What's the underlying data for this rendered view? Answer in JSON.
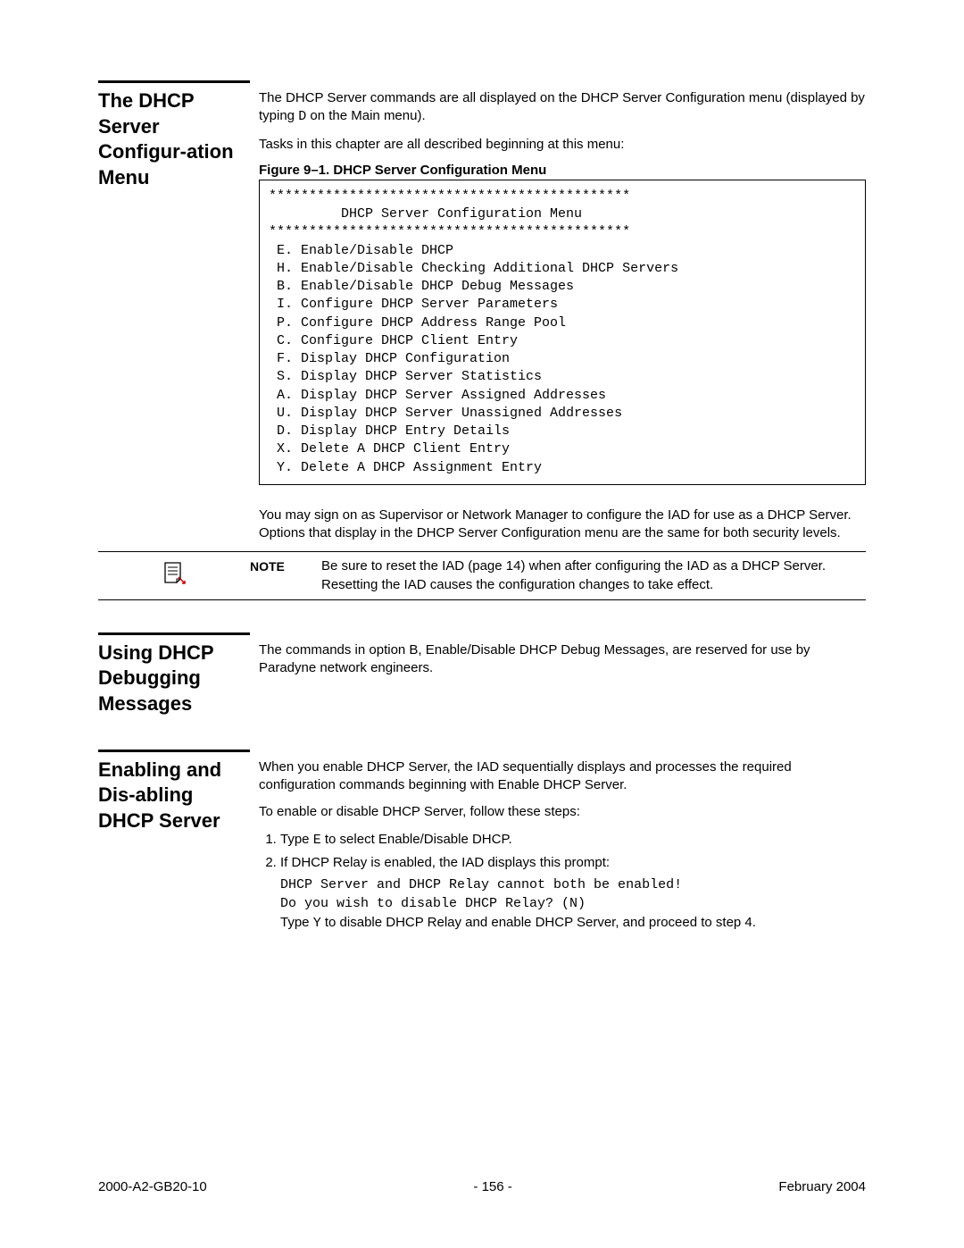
{
  "section1": {
    "heading": "The DHCP Server Configur-ation Menu",
    "para1a": "The DHCP Server commands are all displayed on the DHCP Server Configuration menu (displayed by typing ",
    "para1key": "D",
    "para1b": " on the Main menu).",
    "para2": "Tasks in this chapter are all described beginning at this menu:",
    "figureCaption": "Figure 9–1.  DHCP Server Configuration Menu",
    "menuText": "*********************************************\n         DHCP Server Configuration Menu\n*********************************************\n E. Enable/Disable DHCP\n H. Enable/Disable Checking Additional DHCP Servers\n B. Enable/Disable DHCP Debug Messages\n I. Configure DHCP Server Parameters\n P. Configure DHCP Address Range Pool\n C. Configure DHCP Client Entry\n F. Display DHCP Configuration\n S. Display DHCP Server Statistics\n A. Display DHCP Server Assigned Addresses\n U. Display DHCP Server Unassigned Addresses\n D. Display DHCP Entry Details\n X. Delete A DHCP Client Entry\n Y. Delete A DHCP Assignment Entry",
    "para3": "You may sign on as Supervisor or Network Manager to configure the IAD for use as a DHCP Server. Options that display in the DHCP Server Configuration menu are the same for both security levels.",
    "noteLabel": "NOTE",
    "noteText": "Be sure to reset the IAD (page 14) when after configuring the IAD as a DHCP Server. Resetting the IAD causes the configuration changes to take effect."
  },
  "section2": {
    "heading": "Using DHCP Debugging Messages",
    "para1": "The commands in option B, Enable/Disable DHCP Debug Messages, are reserved for use by Paradyne network engineers."
  },
  "section3": {
    "heading": "Enabling and Dis-abling DHCP Server",
    "para1": "When you enable DHCP Server, the IAD sequentially displays and processes the required configuration commands beginning with Enable DHCP Server.",
    "para2": "To enable or disable DHCP Server, follow these steps:",
    "step1a": "Type ",
    "step1key": "E",
    "step1b": " to select Enable/Disable DHCP.",
    "step2": "If DHCP Relay is enabled, the IAD displays this prompt:",
    "promptLine1": "DHCP Server and DHCP Relay cannot both be enabled!",
    "promptLine2": "Do you wish to disable DHCP Relay? (N)",
    "step2suba": "Type ",
    "step2subkey": "Y",
    "step2subb": " to disable DHCP Relay and enable DHCP Server, and proceed to step 4."
  },
  "footer": {
    "left": "2000-A2-GB20-10",
    "center": "- 156 -",
    "right": "February 2004"
  }
}
